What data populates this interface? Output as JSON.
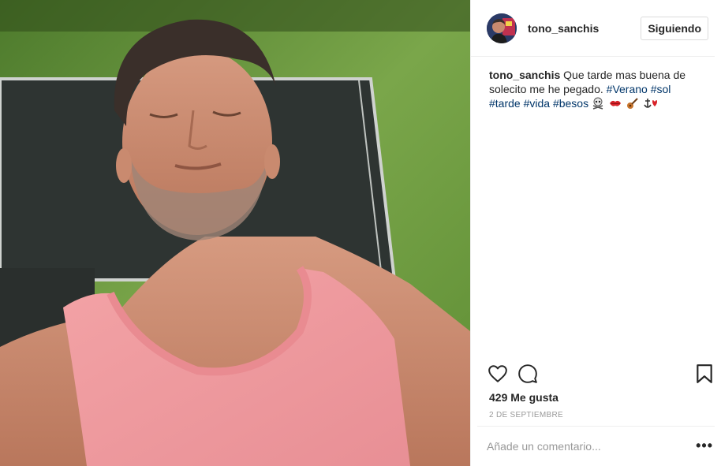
{
  "post": {
    "photo_alt": "",
    "author": {
      "username": "tono_sanchis",
      "follow_label": "Siguiendo"
    },
    "caption": {
      "username": "tono_sanchis",
      "text": "Que tarde mas buena de solecito me he pegado.",
      "hashtags": [
        "#Verano",
        "#sol",
        "#tarde",
        "#vida",
        "#besos"
      ],
      "emojis": [
        "skull-crossbones-emoji",
        "kiss-mark-emoji",
        "guitar-emoji",
        "anchor-heart-emoji"
      ]
    },
    "likes_label": "429 Me gusta",
    "date_label": "2 DE SEPTIEMBRE",
    "comment": {
      "placeholder": "Añade un comentario...",
      "value": ""
    },
    "more_label": "•••",
    "icons": {
      "like": "heart-icon",
      "comment": "comment-icon",
      "save": "bookmark-icon"
    },
    "colors": {
      "hashtag": "#003569",
      "text": "#262626",
      "muted": "#999999",
      "border": "#efefef"
    }
  }
}
